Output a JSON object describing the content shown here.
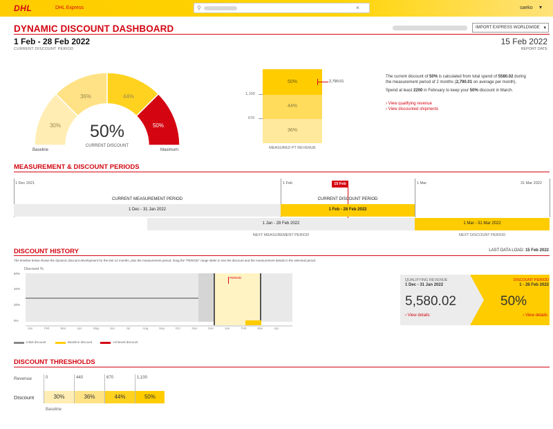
{
  "header": {
    "logo": "DHL",
    "app_name": "DHL Express",
    "search_placeholder": "",
    "user": "saeko"
  },
  "page": {
    "title": "DYNAMIC DISCOUNT DASHBOARD",
    "product_select": "IMPORT EXPRESS WORLDWIDE",
    "period": "1 Feb - 28 Feb 2022",
    "period_label": "CURRENT DISCOUNT PERIOD",
    "report_date": "15 Feb 2022",
    "report_date_label": "REPORT DATE"
  },
  "gauge": {
    "value": "50%",
    "label": "CURRENT DISCOUNT",
    "segments": [
      "30%",
      "36%",
      "44%",
      "50%"
    ],
    "baseline_label": "Baseline",
    "maximum_label": "Maximum",
    "colors": {
      "seg1": "#ffedb3",
      "seg2": "#ffe285",
      "seg3": "#ffd21f",
      "seg4": "#d40511"
    }
  },
  "revenue_bar": {
    "cells": [
      "50%",
      "44%",
      "36%"
    ],
    "ticks": [
      "1,100",
      "670"
    ],
    "marker_value": "2,790.01",
    "label": "MEASURED PT REVENUE"
  },
  "info": {
    "line1a": "The current discount of ",
    "line1b": "50%",
    "line1c": " is calculated from total spend of ",
    "line1d": "5580.02",
    "line1e": " during",
    "line2a": "the measurement period of 2 months (",
    "line2b": "2,790.01",
    "line2c": " on average per month).",
    "line3a": "Spend at least ",
    "line3b": "2200",
    "line3c": " in February to keep your ",
    "line3d": "50%",
    "line3e": " discount in March.",
    "link1": "View qualifying revenue",
    "link2": "View discounted shipments"
  },
  "periods": {
    "title": "MEASUREMENT & DISCOUNT PERIODS",
    "tick_start": "1 Dec 2021",
    "tick_feb": "1 Feb",
    "tick_mar": "1 Mar",
    "tick_end": "31 Mar 2022",
    "today": "15 Feb",
    "current_measurement_label": "CURRENT MEASUREMENT PERIOD",
    "current_measurement": "1 Dec - 31 Jan 2022",
    "current_discount_label": "CURRENT DISCOUNT PERIOD",
    "current_discount": "1 Feb - 28 Feb 2022",
    "next_measurement": "1 Jan - 28 Feb 2022",
    "next_measurement_label": "NEXT MEASUREMENT PERIOD",
    "next_discount": "1 Mar - 31 Mar 2022",
    "next_discount_label": "NEXT DISCOUNT PERIOD"
  },
  "history": {
    "title": "DISCOUNT HISTORY",
    "last_load_label": "LAST DATA LOAD:",
    "last_load": "15 Feb 2022",
    "description": "The timeline below shows the dynamic discount development for the last 12 months, plus the measurement period. Drag the \"PERIOD\" range slider to see the discount and the measurement details in the selected period.",
    "y_title": "Discount %",
    "y_ticks": [
      "60%",
      "40%",
      "20%",
      "0%"
    ],
    "months": [
      "Jan",
      "Feb",
      "Mar",
      "Apr",
      "May",
      "Jun",
      "Jul",
      "Aug",
      "Sep",
      "Oct",
      "Nov",
      "Dec",
      "Jan",
      "Feb",
      "Mar",
      "Apr"
    ],
    "marker": "PERIOD",
    "legend": [
      "Initial discount",
      "Baseline discount",
      "Achieved discount"
    ],
    "legend_colors": [
      "#888888",
      "#ffcc00",
      "#d40511"
    ],
    "card": {
      "left_label": "QUALIFYING REVENUE",
      "left_period": "1 Dec - 31 Jan 2022",
      "left_value": "5,580.02",
      "left_link": "View details",
      "right_label": "DISCOUNT PERIOD",
      "right_period": "1 - 28 Feb 2022",
      "right_value": "50%",
      "right_link": "View details"
    }
  },
  "thresholds": {
    "title": "DISCOUNT THRESHOLDS",
    "revenue_label": "Revenue",
    "discount_label": "Discount",
    "revenues": [
      "0",
      "440",
      "670",
      "1,100"
    ],
    "discounts": [
      "30%",
      "36%",
      "44%",
      "50%"
    ],
    "baseline_label": "Baseline"
  },
  "colors": {
    "accent": "#d40511",
    "brand": "#ffcc00"
  }
}
